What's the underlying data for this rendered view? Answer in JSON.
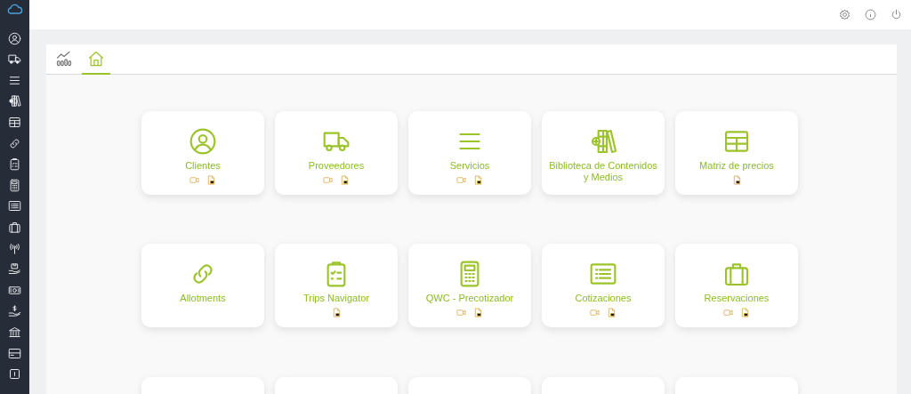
{
  "tabs": [
    {
      "selected": false
    },
    {
      "selected": true
    }
  ],
  "cards": [
    {
      "label": "Clientes",
      "video": true,
      "pdf": true
    },
    {
      "label": "Proveedores",
      "video": true,
      "pdf": true
    },
    {
      "label": "Servicios",
      "video": true,
      "pdf": true
    },
    {
      "label": "Biblioteca de Contenidos y Medios",
      "video": false,
      "pdf": false
    },
    {
      "label": "Matriz de precios",
      "video": false,
      "pdf": true
    },
    {
      "label": "Allotments",
      "video": false,
      "pdf": false
    },
    {
      "label": "Trips Navigator",
      "video": false,
      "pdf": true
    },
    {
      "label": "QWC - Precotizador",
      "video": true,
      "pdf": true
    },
    {
      "label": "Cotizaciones",
      "video": true,
      "pdf": true
    },
    {
      "label": "Reservaciones",
      "video": true,
      "pdf": true
    }
  ]
}
